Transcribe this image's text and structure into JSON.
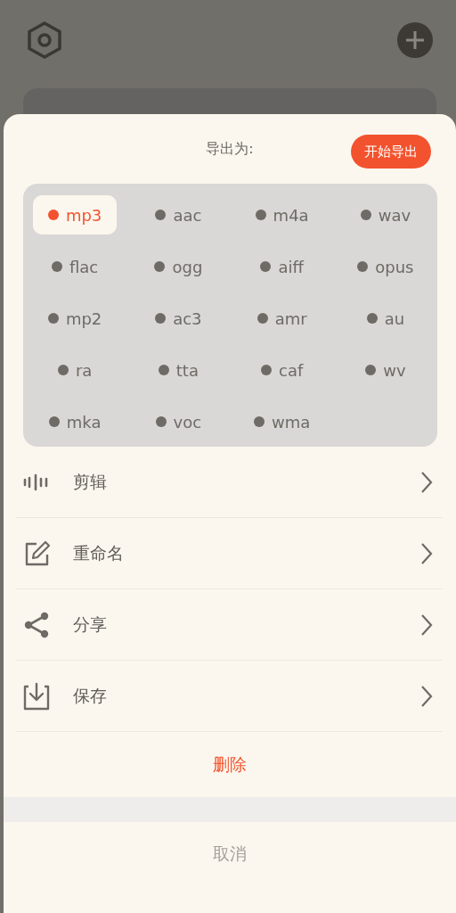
{
  "sheet": {
    "title": "导出为:",
    "start_button": "开始导出"
  },
  "formats": [
    {
      "label": "mp3",
      "selected": true
    },
    {
      "label": "aac",
      "selected": false
    },
    {
      "label": "m4a",
      "selected": false
    },
    {
      "label": "wav",
      "selected": false
    },
    {
      "label": "flac",
      "selected": false
    },
    {
      "label": "ogg",
      "selected": false
    },
    {
      "label": "aiff",
      "selected": false
    },
    {
      "label": "opus",
      "selected": false
    },
    {
      "label": "mp2",
      "selected": false
    },
    {
      "label": "ac3",
      "selected": false
    },
    {
      "label": "amr",
      "selected": false
    },
    {
      "label": "au",
      "selected": false
    },
    {
      "label": "ra",
      "selected": false
    },
    {
      "label": "tta",
      "selected": false
    },
    {
      "label": "caf",
      "selected": false
    },
    {
      "label": "wv",
      "selected": false
    },
    {
      "label": "mka",
      "selected": false
    },
    {
      "label": "voc",
      "selected": false
    },
    {
      "label": "wma",
      "selected": false
    }
  ],
  "actions": [
    {
      "kind": "waveform",
      "label": "剪辑"
    },
    {
      "kind": "edit",
      "label": "重命名"
    },
    {
      "kind": "share",
      "label": "分享"
    },
    {
      "kind": "download",
      "label": "保存"
    }
  ],
  "delete_button": "删除",
  "cancel_button": "取消"
}
